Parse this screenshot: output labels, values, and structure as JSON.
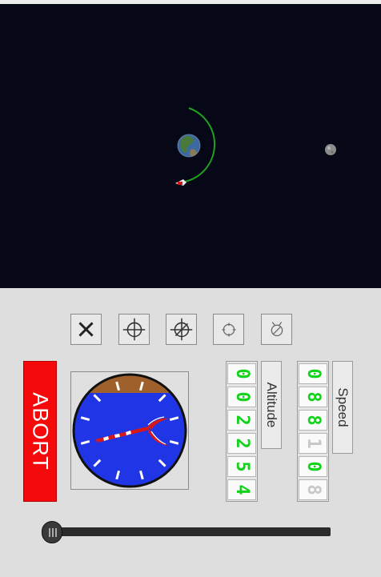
{
  "abort_label": "ABORT",
  "altitude_label": "Altitude",
  "speed_label": "Speed",
  "altitude_digits": [
    "0",
    "0",
    "2",
    "2",
    "5",
    "4"
  ],
  "speed_digits": [
    "0",
    "8",
    "8",
    "1",
    "0",
    "8"
  ],
  "speed_dim": [
    false,
    false,
    false,
    true,
    false,
    true
  ],
  "throttle_level": 0,
  "toolbar": [
    {
      "name": "close-icon"
    },
    {
      "name": "target-icon"
    },
    {
      "name": "target-crossed-icon"
    },
    {
      "name": "crosshair-icon"
    },
    {
      "name": "crosshair-crossed-icon"
    }
  ],
  "colors": {
    "space": "#060818",
    "orbit": "#1fa01f",
    "abort": "#f40a0a",
    "sky": "#2035e6",
    "ground": "#a0602c",
    "lcd_digit": "#12d21a"
  }
}
